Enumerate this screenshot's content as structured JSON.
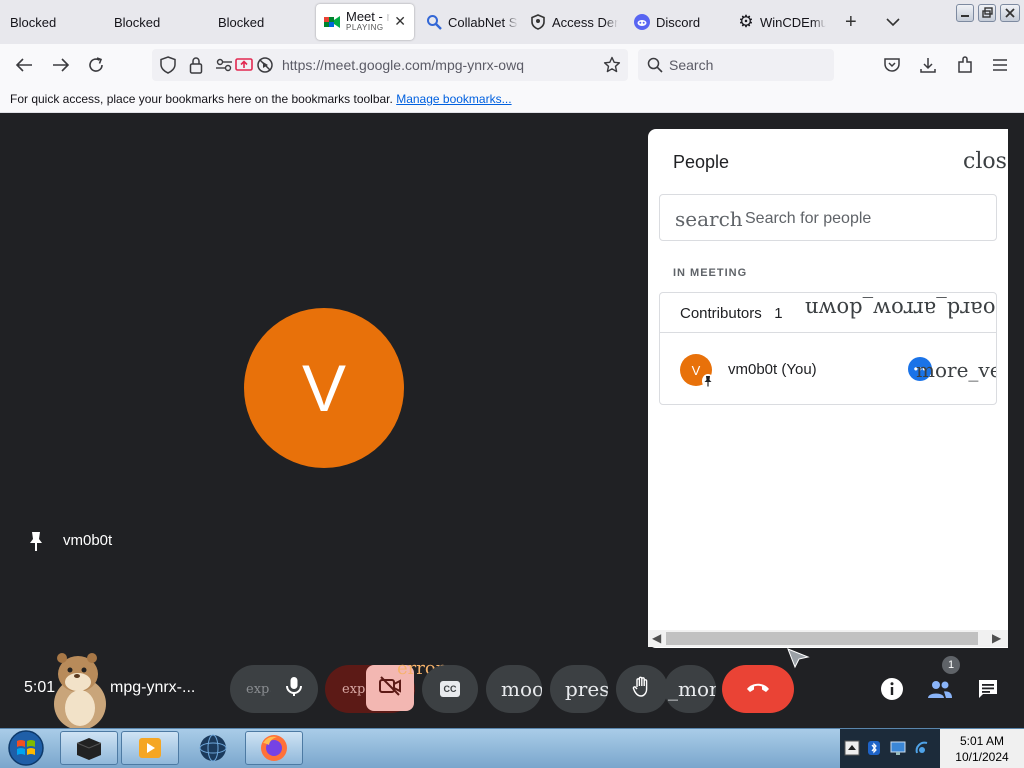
{
  "browser": {
    "tabs": [
      {
        "label": "Blocked"
      },
      {
        "label": "Blocked"
      },
      {
        "label": "Blocked"
      },
      {
        "label": "Meet - m",
        "sublabel": "PLAYING",
        "active": true
      },
      {
        "label": "CollabNet S"
      },
      {
        "label": "Access Den"
      },
      {
        "label": "Discord"
      },
      {
        "label": "WinCDEmu"
      }
    ],
    "new_tab": "+",
    "tab_list": "⌄",
    "url": "https://meet.google.com/mpg-ynrx-owq",
    "search_placeholder": "Search",
    "bookmarks_text": "For quick access, place your bookmarks here on the bookmarks toolbar.",
    "manage_bookmarks": "Manage bookmarks..."
  },
  "meet": {
    "participant_initial": "V",
    "participant_name": "vm0b0t",
    "panel": {
      "title": "People",
      "close_label": "close",
      "search_icon_text": "search",
      "search_placeholder": "Search for people",
      "section_label": "IN MEETING",
      "group_label": "Contributors",
      "group_count": "1",
      "group_expand_icon_text": "keyboard_arrow_down",
      "person_initial": "V",
      "person_name": "vm0b0t (You)",
      "person_more_icon_text": "more_vert"
    },
    "controls": {
      "time": "5:01",
      "meeting_code": "mpg-ynrx-...",
      "expand_less_1": "expand_less",
      "expand_less_2": "expand_less",
      "error_label": "error",
      "cc_label": "CC",
      "mood_label": "mood",
      "present_label": "present_to_all",
      "more_label": "_more",
      "participants_badge": "1"
    }
  },
  "taskbar": {
    "time": "5:01 AM",
    "date": "10/1/2024"
  },
  "colors": {
    "meet_bg": "#202124",
    "avatar": "#e8710a",
    "end_call": "#ea4335",
    "accent_blue": "#1a73e8"
  }
}
